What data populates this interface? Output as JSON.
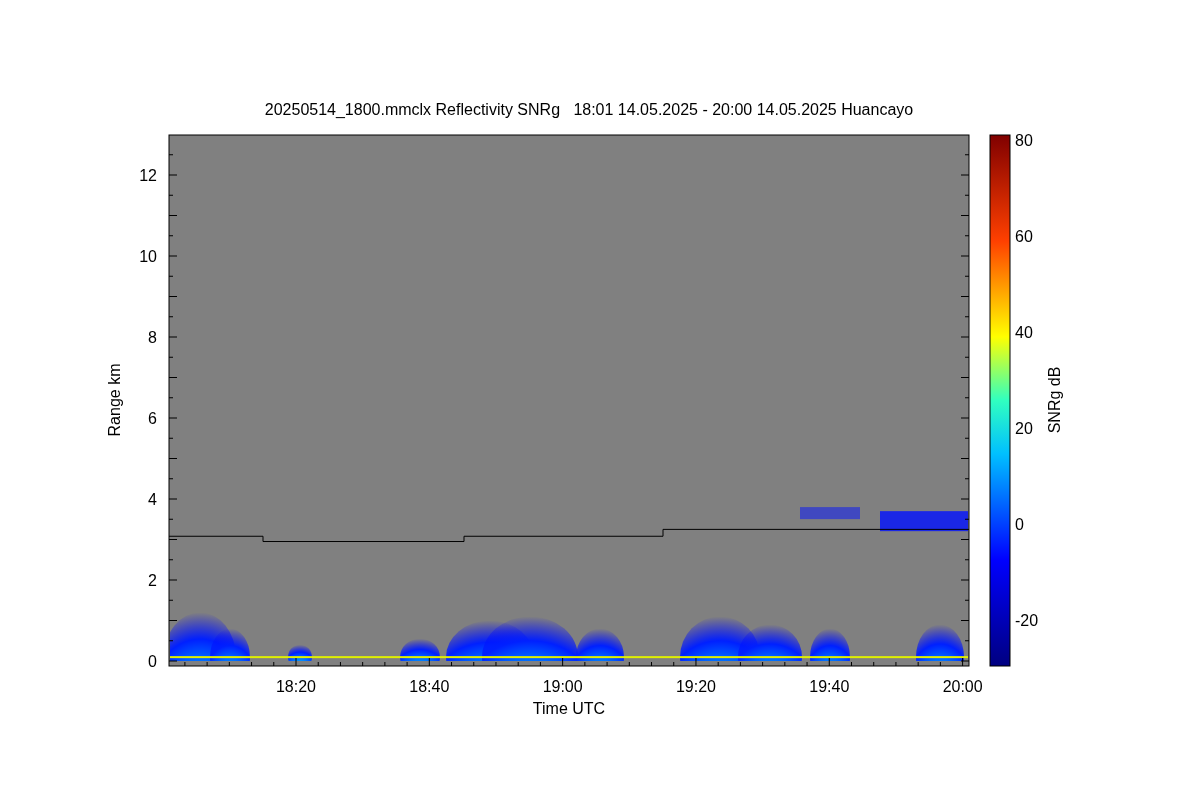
{
  "figure": {
    "title": "20250514_1800.mmclx Reflectivity SNRg   18:01 14.05.2025 - 20:00 14.05.2025 Huancayo",
    "y_axis": {
      "label": "Range km",
      "ticks": [
        "12",
        "10",
        "8",
        "6",
        "4",
        "2",
        "0"
      ]
    },
    "x_axis": {
      "label": "Time UTC",
      "ticks": [
        "18:20",
        "18:40",
        "19:00",
        "19:20",
        "19:40",
        "20:00"
      ]
    },
    "colorbar": {
      "label": "SNRg dB",
      "ticks": [
        "80",
        "60",
        "40",
        "20",
        "0",
        "-20"
      ]
    }
  }
}
